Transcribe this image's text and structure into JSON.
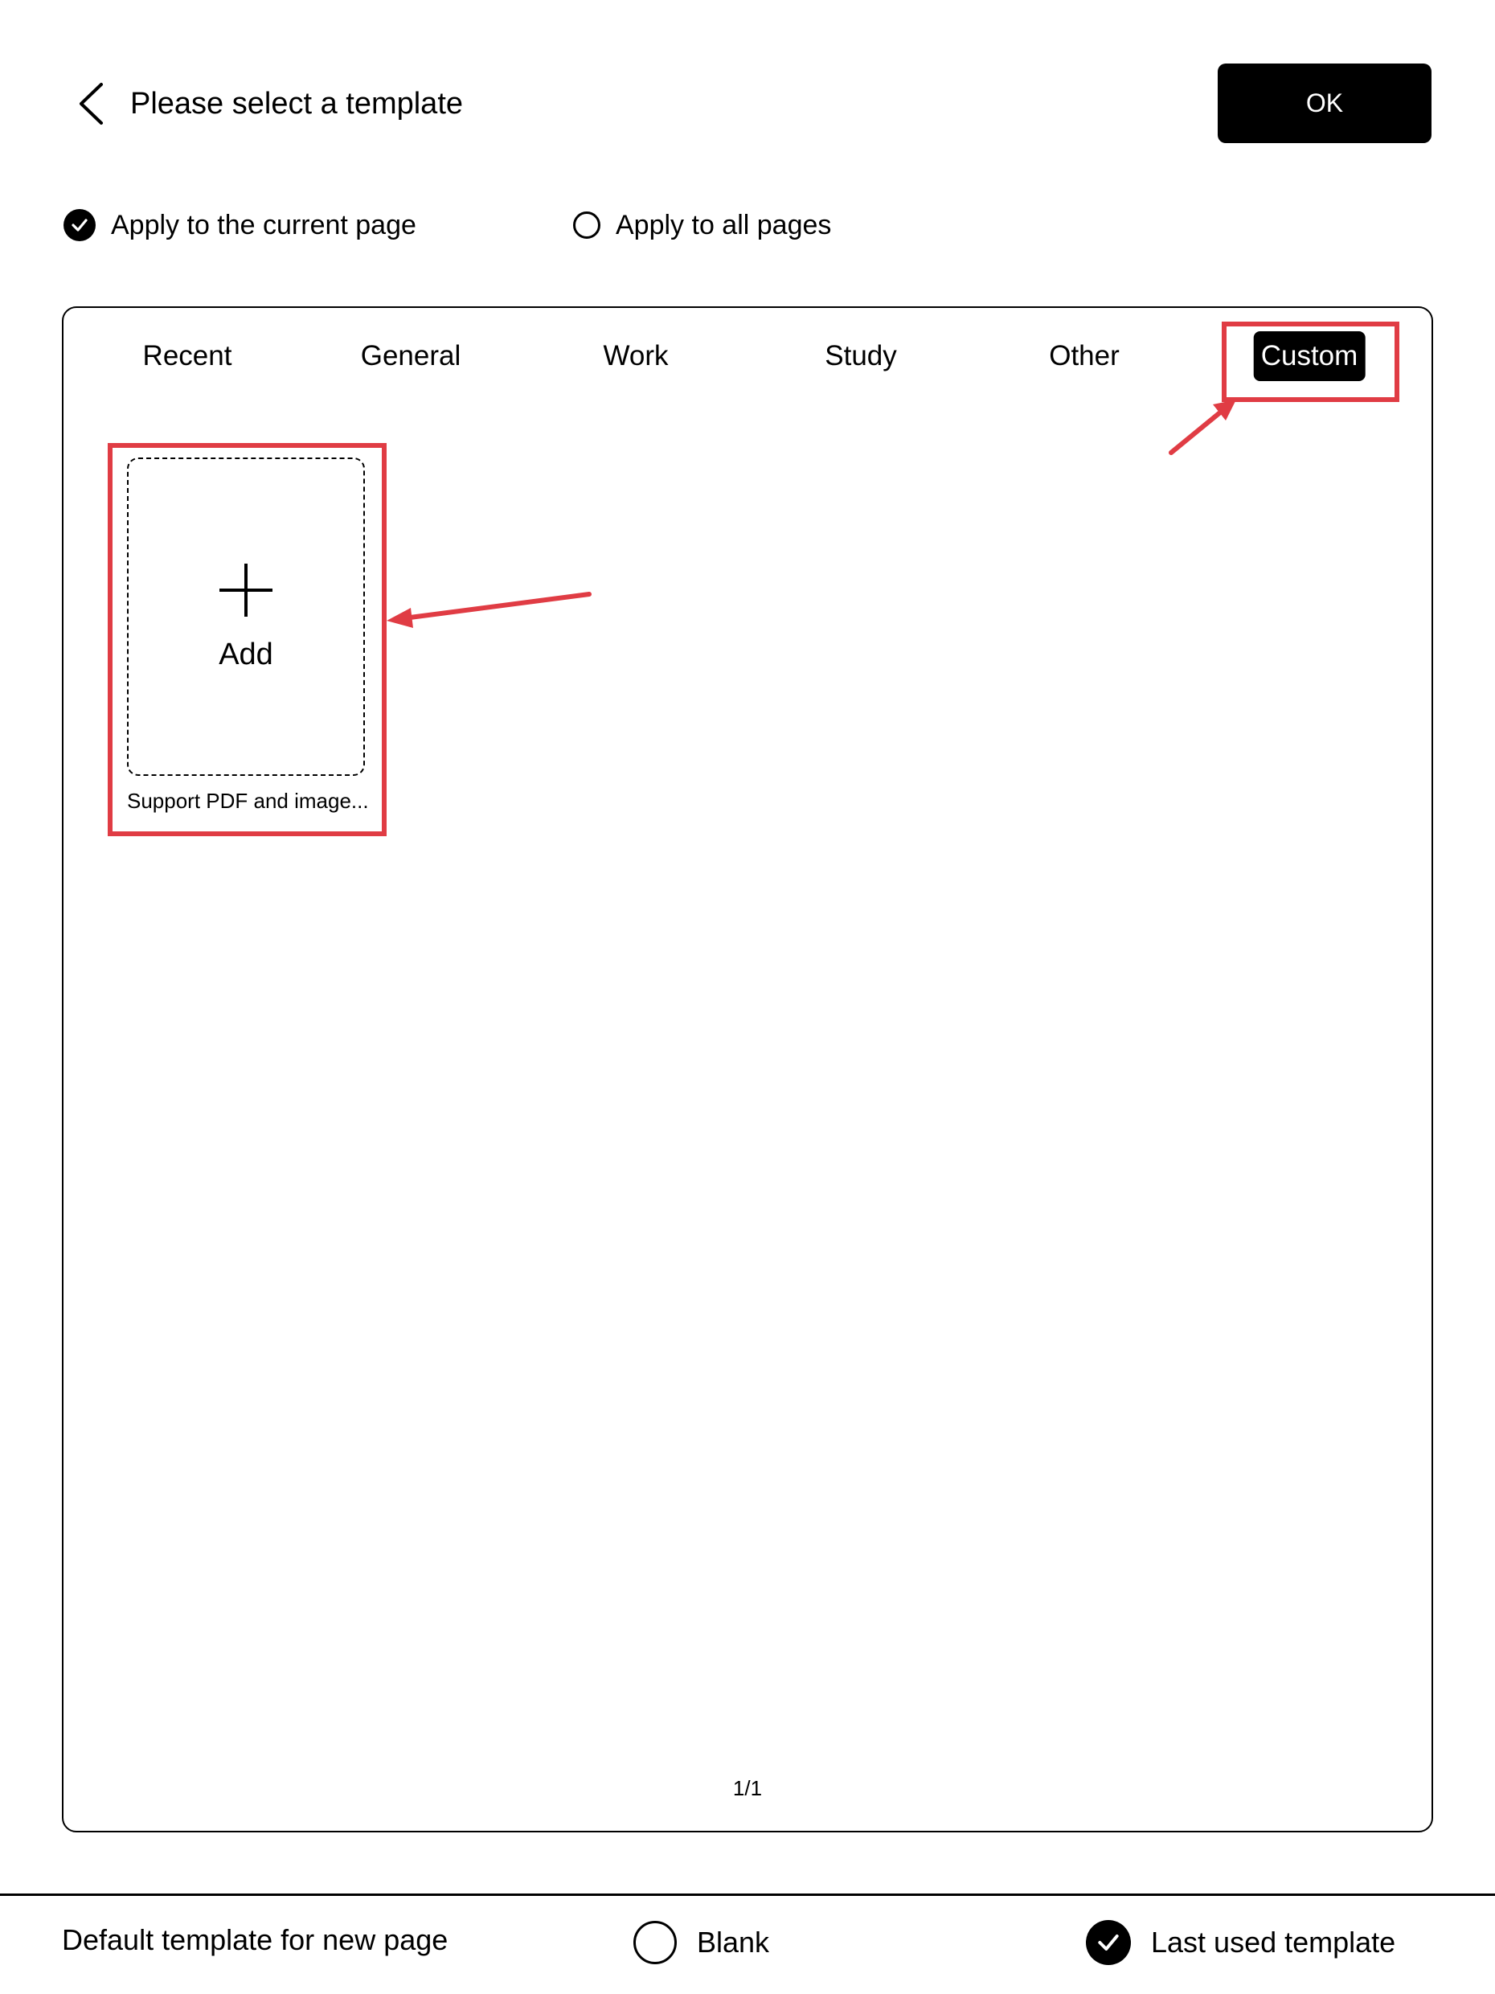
{
  "header": {
    "title": "Please select a template",
    "ok_label": "OK",
    "back_icon": "chevron-left-icon"
  },
  "apply_scope": {
    "current_page_label": "Apply to the current page",
    "current_page_selected": true,
    "all_pages_label": "Apply to all pages",
    "all_pages_selected": false
  },
  "tabs": [
    {
      "label": "Recent",
      "active": false
    },
    {
      "label": "General",
      "active": false
    },
    {
      "label": "Work",
      "active": false
    },
    {
      "label": "Study",
      "active": false
    },
    {
      "label": "Other",
      "active": false
    },
    {
      "label": "Custom",
      "active": true
    }
  ],
  "custom": {
    "add_label": "Add",
    "add_icon": "plus-icon",
    "support_text": "Support PDF and image..."
  },
  "pagination": {
    "text": "1/1"
  },
  "footer": {
    "label": "Default template for new page",
    "options": [
      {
        "label": "Blank",
        "selected": false
      },
      {
        "label": "Last used template",
        "selected": true
      }
    ]
  },
  "colors": {
    "annotation": "#e03c44",
    "accent": "#000000"
  }
}
